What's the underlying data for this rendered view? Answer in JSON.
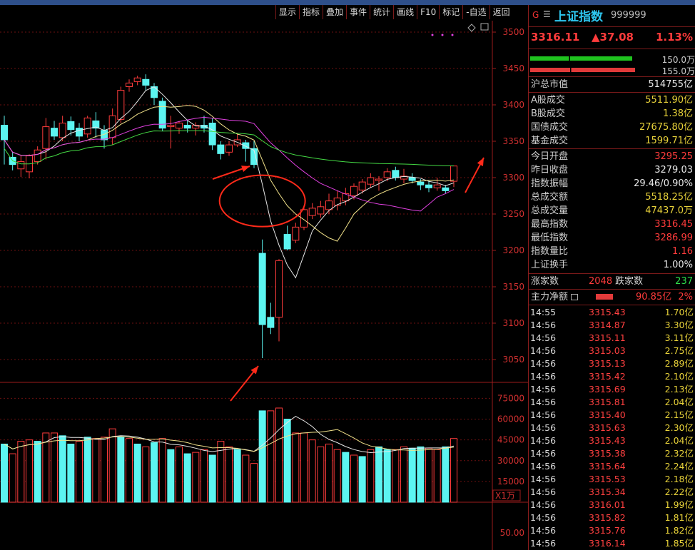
{
  "toolbar": [
    "显示",
    "指标",
    "叠加",
    "事件",
    "统计",
    "画线",
    "F10",
    "标记",
    "-自选",
    "返回"
  ],
  "panel": {
    "g": "G",
    "menu": "☰",
    "name": "上证指数",
    "code": "999999",
    "price": "3316.11",
    "change": "▲37.08",
    "pct": "1.13%",
    "bars": [
      {
        "value": "150.0万",
        "color": "#1fc31f",
        "fill": 0.62
      },
      {
        "value": "155.0万",
        "color": "#e23a3a",
        "fill": 0.64
      }
    ],
    "market_cap": {
      "label": "沪总市值",
      "value": "514755亿"
    },
    "stats": [
      {
        "k": "A股成交",
        "v": "5511.90亿",
        "c": "yellow"
      },
      {
        "k": "B股成交",
        "v": "1.38亿",
        "c": "yellow"
      },
      {
        "k": "国债成交",
        "v": "27675.80亿",
        "c": "yellow"
      },
      {
        "k": "基金成交",
        "v": "1599.71亿",
        "c": "yellow"
      }
    ],
    "stats2": [
      {
        "k": "今日开盘",
        "v": "3295.25",
        "c": "red"
      },
      {
        "k": "昨日收盘",
        "v": "3279.03",
        "c": "white"
      },
      {
        "k": "指数振幅",
        "v": "29.46/0.90%",
        "c": "white"
      },
      {
        "k": "总成交额",
        "v": "5518.25亿",
        "c": "yellow"
      },
      {
        "k": "总成交量",
        "v": "47437.0万",
        "c": "yellow"
      },
      {
        "k": "最高指数",
        "v": "3316.45",
        "c": "red"
      },
      {
        "k": "最低指数",
        "v": "3286.99",
        "c": "red"
      },
      {
        "k": "指数量比",
        "v": "1.16",
        "c": "red"
      },
      {
        "k": "上证换手",
        "v": "1.00%",
        "c": "white"
      }
    ],
    "updown": {
      "up_label": "涨家数",
      "up": "2048",
      "down_label": "跌家数",
      "down": "237"
    },
    "mainflow": {
      "label": "主力净额",
      "value": "90.85亿",
      "pct": "2%"
    },
    "ticks": [
      {
        "t": "14:55",
        "p": "3315.43",
        "v": "1.70亿"
      },
      {
        "t": "14:56",
        "p": "3314.87",
        "v": "3.30亿"
      },
      {
        "t": "14:56",
        "p": "3315.11",
        "v": "3.11亿"
      },
      {
        "t": "14:56",
        "p": "3315.03",
        "v": "2.75亿"
      },
      {
        "t": "14:56",
        "p": "3315.13",
        "v": "2.89亿"
      },
      {
        "t": "14:56",
        "p": "3315.42",
        "v": "2.10亿"
      },
      {
        "t": "14:56",
        "p": "3315.69",
        "v": "2.13亿"
      },
      {
        "t": "14:56",
        "p": "3315.81",
        "v": "2.04亿"
      },
      {
        "t": "14:56",
        "p": "3315.40",
        "v": "2.15亿"
      },
      {
        "t": "14:56",
        "p": "3315.63",
        "v": "2.30亿"
      },
      {
        "t": "14:56",
        "p": "3315.43",
        "v": "2.04亿"
      },
      {
        "t": "14:56",
        "p": "3315.38",
        "v": "2.32亿"
      },
      {
        "t": "14:56",
        "p": "3315.64",
        "v": "2.24亿"
      },
      {
        "t": "14:56",
        "p": "3315.53",
        "v": "2.18亿"
      },
      {
        "t": "14:56",
        "p": "3315.34",
        "v": "2.22亿"
      },
      {
        "t": "14:56",
        "p": "3316.01",
        "v": "1.99亿"
      },
      {
        "t": "14:56",
        "p": "3315.82",
        "v": "1.81亿"
      },
      {
        "t": "14:56",
        "p": "3315.76",
        "v": "1.82亿"
      },
      {
        "t": "14:56",
        "p": "3316.14",
        "v": "1.85亿"
      }
    ]
  },
  "chart_data": {
    "type": "candlestick",
    "price_axis": {
      "ticks": [
        3500,
        3450,
        3400,
        3350,
        3300,
        3250,
        3200,
        3150,
        3100,
        3050
      ],
      "range": [
        3020,
        3520
      ]
    },
    "volume_axis": {
      "ticks": [
        75000,
        60000,
        45000,
        30000,
        15000
      ],
      "labels": [
        "75000",
        "60000",
        "45000",
        "30000",
        "15000"
      ],
      "range": [
        0,
        85000
      ],
      "unit": "X1万"
    },
    "lower_axis": {
      "ticks": [
        50.0
      ],
      "labels": [
        "50.00"
      ]
    },
    "candles": [
      [
        3372,
        3352,
        3318,
        3385,
        42
      ],
      [
        3328,
        3318,
        3310,
        3335,
        35
      ],
      [
        3312,
        3322,
        3301,
        3330,
        44
      ],
      [
        3308,
        3330,
        3299,
        3332,
        45
      ],
      [
        3322,
        3338,
        3318,
        3343,
        44
      ],
      [
        3340,
        3370,
        3325,
        3382,
        50
      ],
      [
        3368,
        3357,
        3352,
        3378,
        50
      ],
      [
        3355,
        3375,
        3350,
        3385,
        48
      ],
      [
        3377,
        3366,
        3358,
        3384,
        42
      ],
      [
        3368,
        3357,
        3350,
        3375,
        44
      ],
      [
        3360,
        3382,
        3355,
        3385,
        47
      ],
      [
        3378,
        3368,
        3355,
        3390,
        46
      ],
      [
        3365,
        3352,
        3340,
        3372,
        47
      ],
      [
        3355,
        3385,
        3345,
        3395,
        53
      ],
      [
        3380,
        3420,
        3375,
        3425,
        47
      ],
      [
        3425,
        3430,
        3418,
        3435,
        46
      ],
      [
        3432,
        3437,
        3427,
        3440,
        42
      ],
      [
        3435,
        3427,
        3420,
        3442,
        40
      ],
      [
        3425,
        3410,
        3400,
        3430,
        43
      ],
      [
        3405,
        3368,
        3364,
        3410,
        46
      ],
      [
        3370,
        3372,
        3340,
        3385,
        38
      ],
      [
        3368,
        3375,
        3360,
        3378,
        40
      ],
      [
        3372,
        3368,
        3362,
        3380,
        35
      ],
      [
        3368,
        3372,
        3358,
        3376,
        36
      ],
      [
        3372,
        3368,
        3362,
        3385,
        38
      ],
      [
        3375,
        3345,
        3338,
        3382,
        34
      ],
      [
        3345,
        3333,
        3325,
        3350,
        44
      ],
      [
        3335,
        3345,
        3330,
        3350,
        40
      ],
      [
        3345,
        3352,
        3342,
        3360,
        38
      ],
      [
        3348,
        3340,
        3322,
        3352,
        34
      ],
      [
        3340,
        3318,
        3313,
        3350,
        28
      ],
      [
        3196,
        3098,
        3052,
        3215,
        66
      ],
      [
        3108,
        3094,
        3085,
        3128,
        66
      ],
      [
        3108,
        3186,
        3075,
        3188,
        68
      ],
      [
        3222,
        3202,
        3200,
        3234,
        60
      ],
      [
        3214,
        3232,
        3210,
        3238,
        50
      ],
      [
        3232,
        3256,
        3228,
        3262,
        50
      ],
      [
        3248,
        3258,
        3243,
        3265,
        45
      ],
      [
        3250,
        3260,
        3245,
        3268,
        40
      ],
      [
        3256,
        3268,
        3250,
        3278,
        42
      ],
      [
        3262,
        3272,
        3255,
        3282,
        38
      ],
      [
        3268,
        3278,
        3262,
        3286,
        36
      ],
      [
        3275,
        3288,
        3270,
        3292,
        34
      ],
      [
        3283,
        3294,
        3278,
        3298,
        33
      ],
      [
        3291,
        3300,
        3286,
        3306,
        38
      ],
      [
        3296,
        3298,
        3282,
        3302,
        40
      ],
      [
        3300,
        3308,
        3295,
        3313,
        38
      ],
      [
        3310,
        3300,
        3296,
        3315,
        38
      ],
      [
        3298,
        3302,
        3292,
        3312,
        40
      ],
      [
        3300,
        3296,
        3292,
        3306,
        39
      ],
      [
        3294,
        3290,
        3283,
        3298,
        40
      ],
      [
        3290,
        3286,
        3280,
        3296,
        39
      ],
      [
        3286,
        3290,
        3282,
        3300,
        38
      ],
      [
        3286,
        3282,
        3278,
        3290,
        40
      ],
      [
        3295,
        3316,
        3287,
        3316,
        46
      ]
    ],
    "bar_colors_cyan": [
      0,
      4,
      7,
      8,
      10,
      14,
      16,
      18,
      20,
      22,
      25,
      28,
      31,
      34,
      41,
      43,
      45,
      46,
      49,
      50,
      53
    ],
    "circle_annotation": {
      "price": 3268,
      "index": 31
    },
    "arrows": 3
  },
  "colors": {
    "up": "#ff3b3b",
    "down": "#5cf5f1",
    "ma5": "#e6e6e6",
    "ma10": "#f2e28a",
    "ma20": "#e040e0",
    "ma60": "#44d944",
    "grid": "#6b1111",
    "axis": "#9b1d1d"
  }
}
